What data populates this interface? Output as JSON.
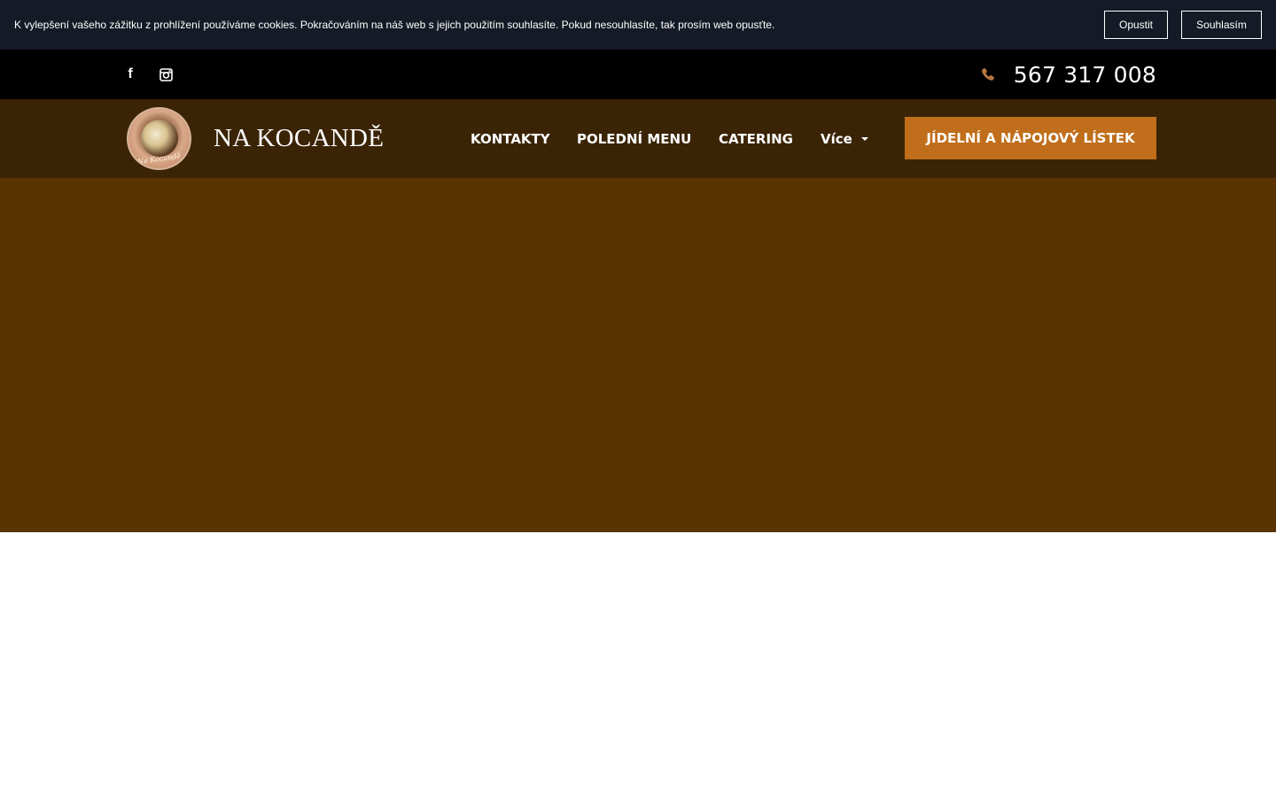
{
  "cookie_bar": {
    "text": "K vylepšení vašeho zážitku z prohlížení používáme cookies. Pokračováním na náš web s jejich použitím souhlasíte. Pokud nesouhlasíte, tak prosím web opusťte.",
    "leave_label": "Opustit",
    "agree_label": "Souhlasím"
  },
  "topbar": {
    "social": {
      "facebook_icon": "facebook-icon",
      "facebook_glyph": "f",
      "instagram_icon": "instagram-icon"
    },
    "phone_icon": "phone-icon",
    "phone": "567 317 008"
  },
  "header": {
    "logo_icon": "restaurant-logo",
    "logo_script": "Na Kocandě",
    "brand": "NA KOCANDĚ",
    "nav": {
      "kontakty": "KONTAKTY",
      "poledni": "POLEDNÍ MENU",
      "catering": "CATERING",
      "vice": "Více"
    },
    "cta": "JÍDELNÍ A NÁPOJOVÝ LÍSTEK"
  },
  "colors": {
    "cookie_bg": "#151b26",
    "topbar_bg": "#000000",
    "header_bg": "#3b2406",
    "hero_bg": "#5a3303",
    "cta_bg": "#c06e1b",
    "phone_icon": "#b5763f"
  }
}
